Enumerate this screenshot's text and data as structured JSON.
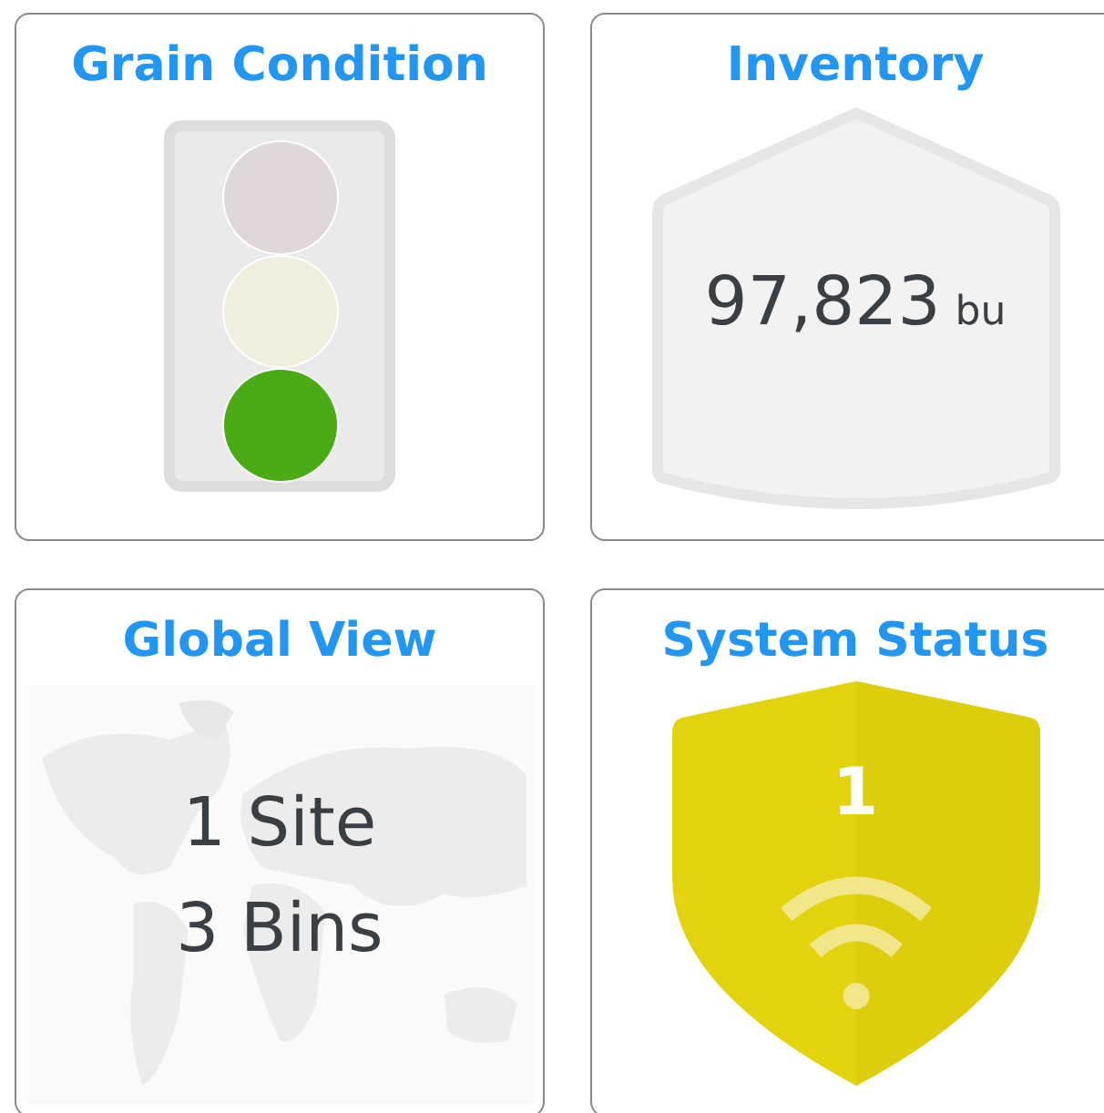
{
  "cards": [
    {
      "kind": "traffic-light",
      "title": "Grain Condition",
      "lights": [
        {
          "color": "#e0d8d8"
        },
        {
          "color": "#f0eedc"
        },
        {
          "color": "#4aab14"
        }
      ]
    },
    {
      "kind": "inventory",
      "title": "Inventory",
      "value": "97,823",
      "unit": "bu"
    },
    {
      "kind": "map",
      "title": "Global View",
      "lines": [
        "1 Site",
        "3 Bins"
      ]
    },
    {
      "kind": "status",
      "title": "System Status",
      "count": "1"
    }
  ]
}
